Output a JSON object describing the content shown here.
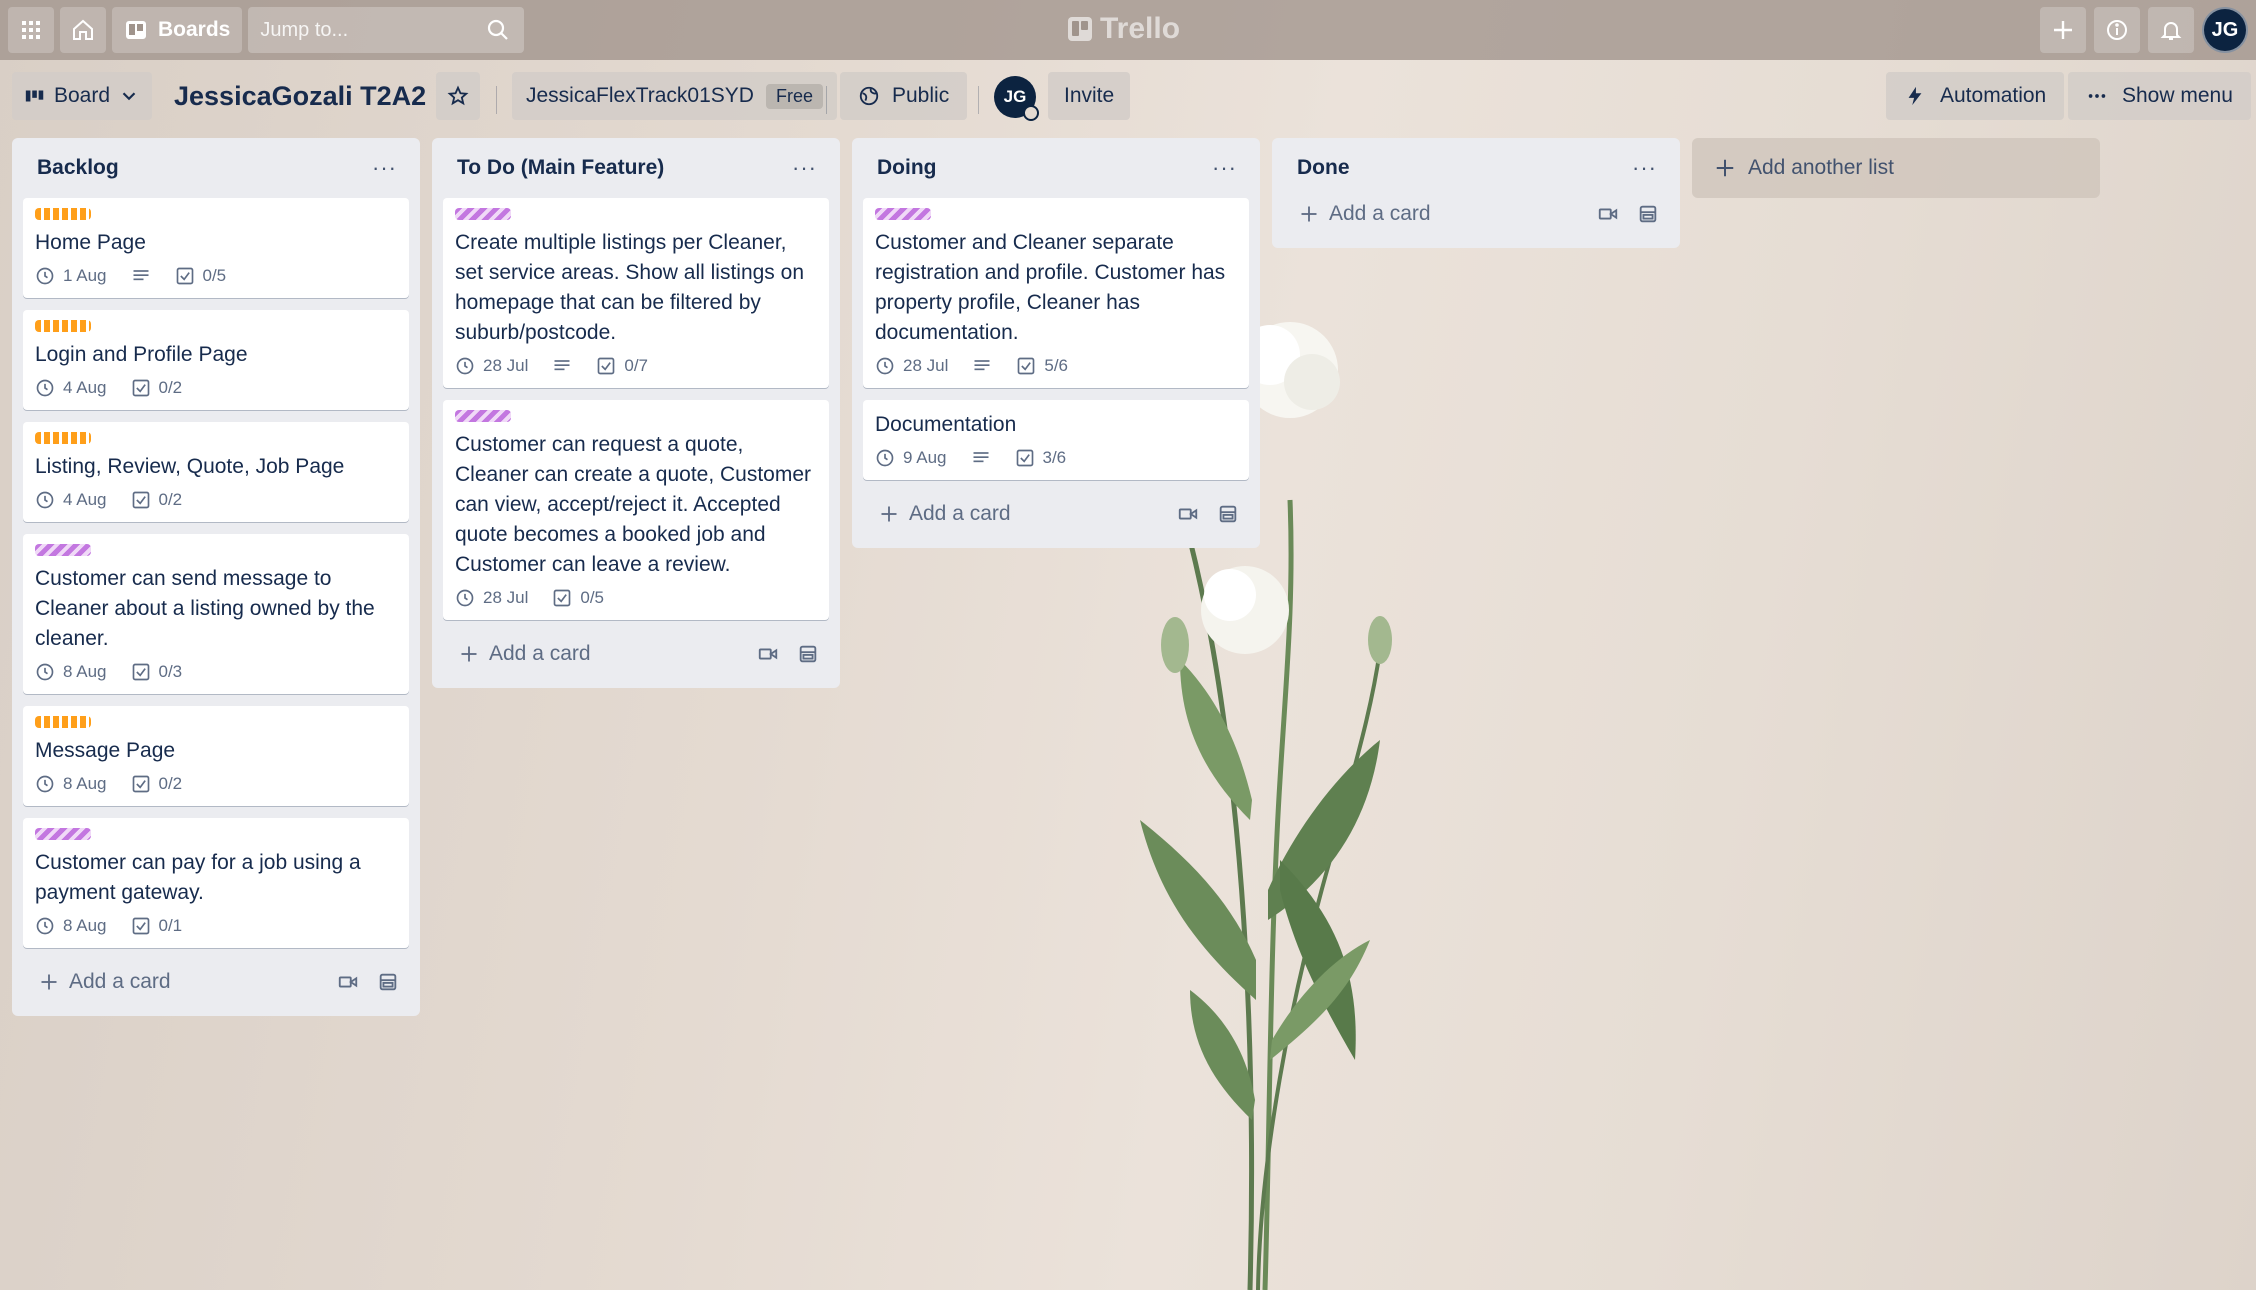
{
  "header": {
    "boards_label": "Boards",
    "search_placeholder": "Jump to...",
    "logo_text": "Trello",
    "avatar_initials": "JG"
  },
  "board": {
    "view_label": "Board",
    "title": "JessicaGozali T2A2",
    "workspace": "JessicaFlexTrack01SYD",
    "workspace_badge": "Free",
    "visibility": "Public",
    "member_initials": "JG",
    "invite_label": "Invite",
    "automation_label": "Automation",
    "menu_label": "Show menu"
  },
  "label_colors": {
    "orange": "#ff9f1a",
    "purple": "#c377e0"
  },
  "add_card_label": "Add a card",
  "add_list_label": "Add another list",
  "lists": [
    {
      "title": "Backlog",
      "cards": [
        {
          "label": "orange",
          "title": "Home Page",
          "due": "1 Aug",
          "has_description": true,
          "checklist": "0/5"
        },
        {
          "label": "orange",
          "title": "Login and Profile Page",
          "due": "4 Aug",
          "checklist": "0/2"
        },
        {
          "label": "orange",
          "title": "Listing, Review, Quote, Job Page",
          "due": "4 Aug",
          "checklist": "0/2"
        },
        {
          "label": "purple",
          "title": "Customer can send message to Cleaner about a listing owned by the cleaner.",
          "due": "8 Aug",
          "checklist": "0/3"
        },
        {
          "label": "orange",
          "title": "Message Page",
          "due": "8 Aug",
          "checklist": "0/2"
        },
        {
          "label": "purple",
          "title": "Customer can pay for a job using a payment gateway.",
          "due": "8 Aug",
          "checklist": "0/1"
        }
      ]
    },
    {
      "title": "To Do (Main Feature)",
      "cards": [
        {
          "label": "purple",
          "title": "Create multiple listings per Cleaner, set service areas. Show all listings on homepage that can be filtered by suburb/postcode.",
          "due": "28 Jul",
          "has_description": true,
          "checklist": "0/7"
        },
        {
          "label": "purple",
          "title": "Customer can request a quote, Cleaner can create a quote, Customer can view, accept/reject it. Accepted quote becomes a booked job and Customer can leave a review.",
          "due": "28 Jul",
          "checklist": "0/5"
        }
      ]
    },
    {
      "title": "Doing",
      "cards": [
        {
          "label": "purple",
          "title": "Customer and Cleaner separate registration and profile. Customer has property profile, Cleaner has documentation.",
          "due": "28 Jul",
          "has_description": true,
          "checklist": "5/6"
        },
        {
          "title": "Documentation",
          "due": "9 Aug",
          "has_description": true,
          "checklist": "3/6"
        }
      ]
    },
    {
      "title": "Done",
      "cards": []
    }
  ]
}
